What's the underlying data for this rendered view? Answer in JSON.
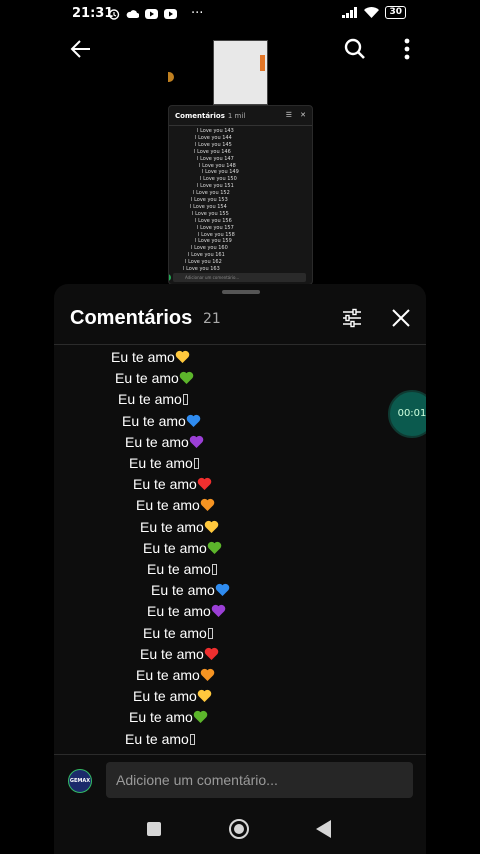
{
  "status_bar": {
    "time": "21:31",
    "battery": "30"
  },
  "mini_preview": {
    "title": "Comentários",
    "count": "1 mil",
    "lines": [
      "I Love you 143",
      "I Love you 144",
      "I Love you 145",
      "I Love you 146",
      "I Love you 147",
      "I Love you 148",
      "I Love you 149",
      "I Love you 150",
      "I Love you 151",
      "I Love you 152",
      "I Love you 153",
      "I Love you 154",
      "I Love you 155",
      "I Love you 156",
      "I Love you 157",
      "I Love you 158",
      "I Love you 159",
      "I Love you 160",
      "I Love you 161",
      "I Love you 162",
      "I Love you 163",
      "I Love you 164"
    ],
    "input_placeholder": "Adicionar um comentário..."
  },
  "comments_panel": {
    "title": "Comentários",
    "count": "21",
    "lines": [
      {
        "text": "Eu te amo",
        "heart": "yellow-heart-icon",
        "color": "#ffc83d"
      },
      {
        "text": "Eu te amo",
        "heart": "green-heart-icon",
        "color": "#5cb52b"
      },
      {
        "text": "Eu te amo",
        "heart": "missing-glyph-icon",
        "color": ""
      },
      {
        "text": "Eu te amo",
        "heart": "blue-heart-icon",
        "color": "#2f8cf0"
      },
      {
        "text": "Eu te amo",
        "heart": "purple-heart-icon",
        "color": "#9b3fd6"
      },
      {
        "text": "Eu te amo",
        "heart": "missing-glyph-icon",
        "color": ""
      },
      {
        "text": "Eu te amo",
        "heart": "red-heart-icon",
        "color": "#ef2f2f"
      },
      {
        "text": "Eu te amo",
        "heart": "orange-heart-icon",
        "color": "#f79422"
      },
      {
        "text": "Eu te amo",
        "heart": "yellow-heart-icon",
        "color": "#ffc83d"
      },
      {
        "text": "Eu te amo",
        "heart": "green-heart-icon",
        "color": "#5cb52b"
      },
      {
        "text": "Eu te amo",
        "heart": "missing-glyph-icon",
        "color": ""
      },
      {
        "text": "Eu te amo",
        "heart": "blue-heart-icon",
        "color": "#2f8cf0"
      },
      {
        "text": "Eu te amo",
        "heart": "purple-heart-icon",
        "color": "#9b3fd6"
      },
      {
        "text": "Eu te amo",
        "heart": "missing-glyph-icon",
        "color": ""
      },
      {
        "text": "Eu te amo",
        "heart": "red-heart-icon",
        "color": "#ef2f2f"
      },
      {
        "text": "Eu te amo",
        "heart": "orange-heart-icon",
        "color": "#f79422"
      },
      {
        "text": "Eu te amo",
        "heart": "yellow-heart-icon",
        "color": "#ffc83d"
      },
      {
        "text": "Eu te amo",
        "heart": "green-heart-icon",
        "color": "#5cb52b"
      },
      {
        "text": "Eu te amo",
        "heart": "missing-glyph-icon",
        "color": ""
      }
    ],
    "input_placeholder": "Adicione um comentário...",
    "avatar_label": "GEMAX"
  },
  "floating_timer": "00:01"
}
